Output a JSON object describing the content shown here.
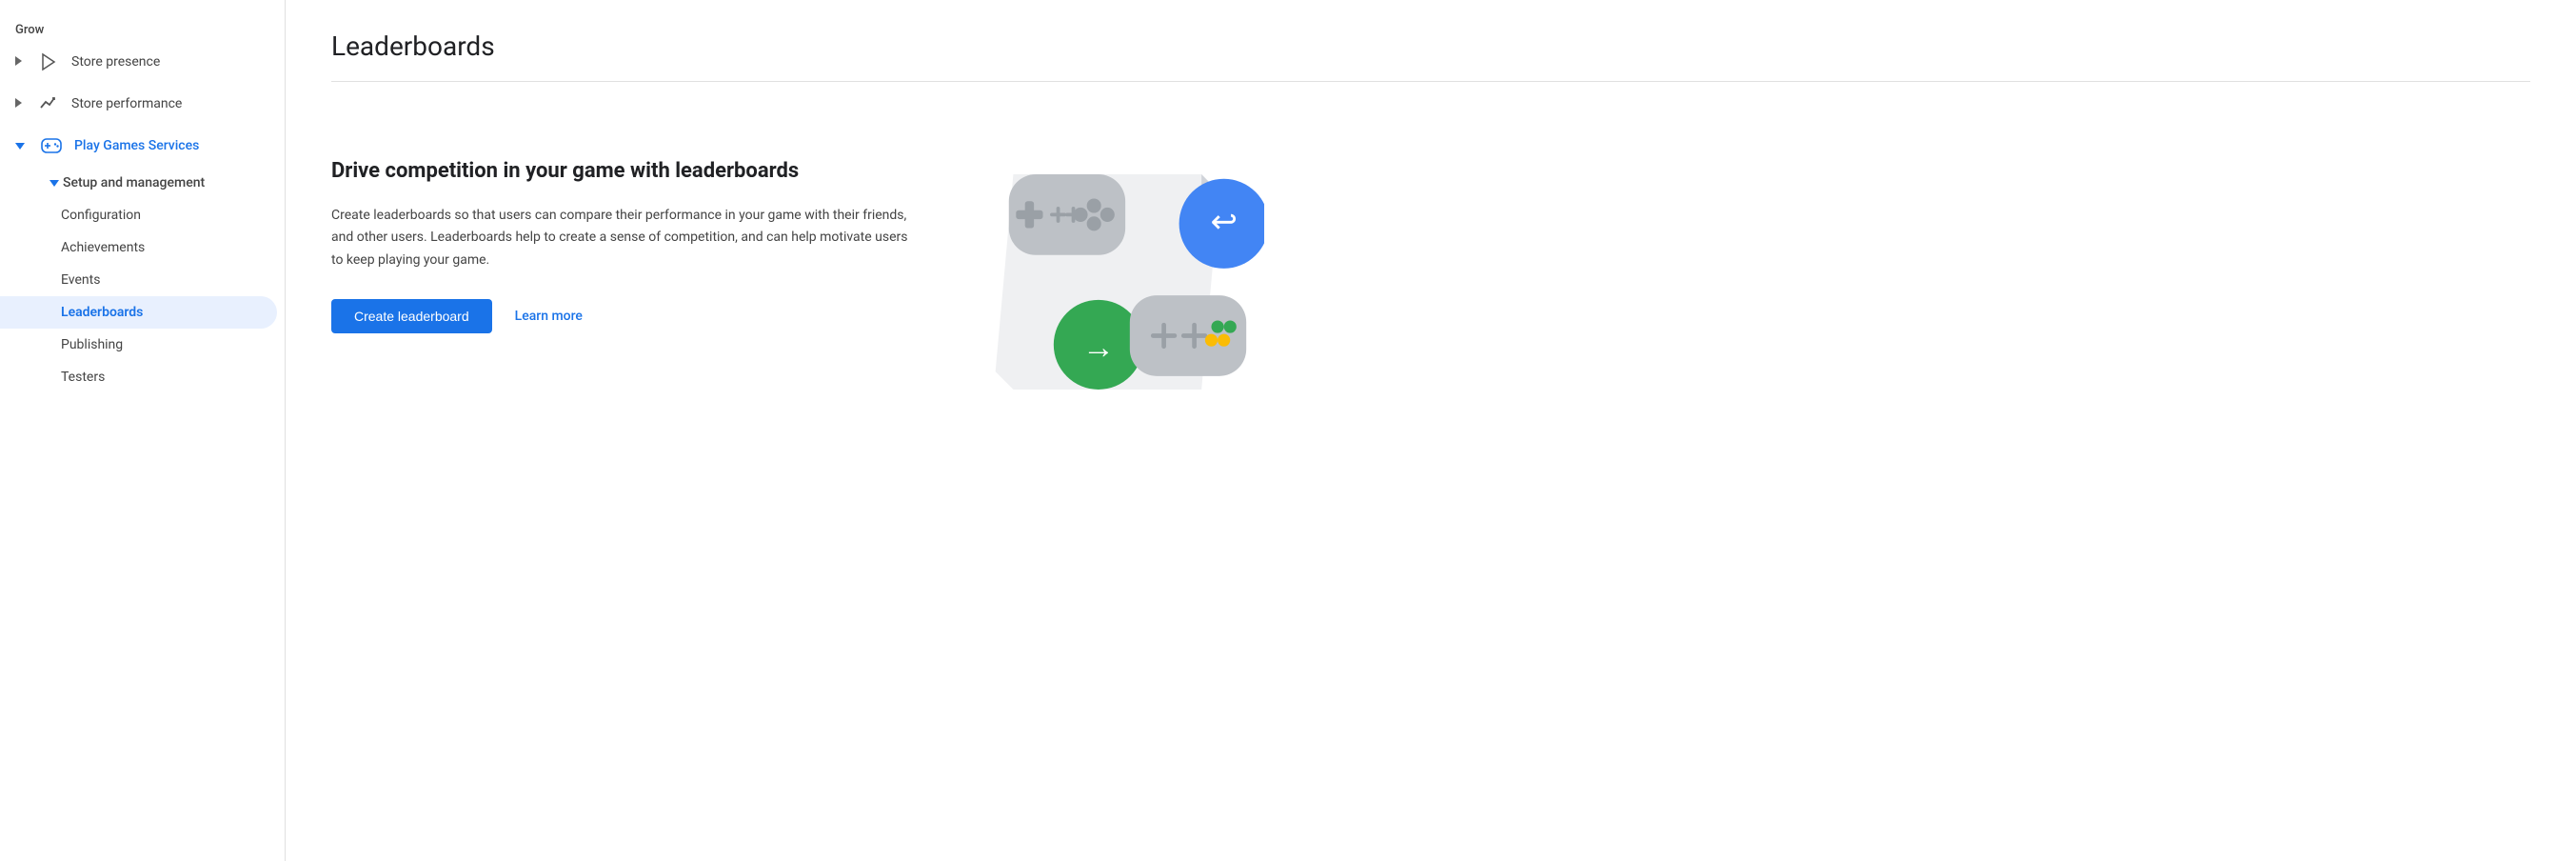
{
  "sidebar": {
    "grow_label": "Grow",
    "items": [
      {
        "id": "store-presence",
        "label": "Store presence",
        "icon": "play-icon",
        "expandable": true,
        "expanded": false,
        "active": false
      },
      {
        "id": "store-performance",
        "label": "Store performance",
        "icon": "chart-icon",
        "expandable": true,
        "expanded": false,
        "active": false
      },
      {
        "id": "play-games-services",
        "label": "Play Games Services",
        "icon": "gamepad-icon",
        "expandable": true,
        "expanded": true,
        "active": true
      }
    ],
    "subitems": [
      {
        "id": "setup-management",
        "label": "Setup and management",
        "level": 1,
        "expandable": true,
        "expanded": true,
        "active": false
      }
    ],
    "subsubitems": [
      {
        "id": "configuration",
        "label": "Configuration",
        "active": false
      },
      {
        "id": "achievements",
        "label": "Achievements",
        "active": false
      },
      {
        "id": "events",
        "label": "Events",
        "active": false
      },
      {
        "id": "leaderboards",
        "label": "Leaderboards",
        "active": true
      },
      {
        "id": "publishing",
        "label": "Publishing",
        "active": false
      },
      {
        "id": "testers",
        "label": "Testers",
        "active": false
      }
    ]
  },
  "main": {
    "page_title": "Leaderboards",
    "content_heading": "Drive competition in your game with leaderboards",
    "content_body": "Create leaderboards so that users can compare their performance in your game with their friends, and other users. Leaderboards help to create a sense of competition, and can help motivate users to keep playing your game.",
    "create_button_label": "Create leaderboard",
    "learn_more_label": "Learn more"
  }
}
